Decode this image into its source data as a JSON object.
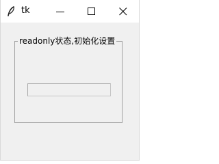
{
  "window": {
    "title": "tk",
    "controls": {
      "minimize_icon": "minimize-icon",
      "maximize_icon": "maximize-icon",
      "close_icon": "close-icon"
    }
  },
  "labelframe": {
    "label": "readonly状态,初始化设置"
  },
  "entry": {
    "value": "",
    "state": "readonly"
  },
  "colors": {
    "titlebar_bg": "#ffffff",
    "window_bg": "#f0f0f0",
    "frame_border": "#a0a0a0"
  }
}
